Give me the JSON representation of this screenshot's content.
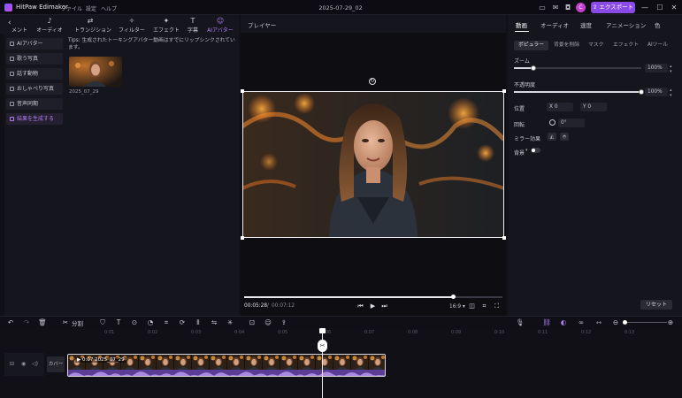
{
  "app": {
    "name": "HitPaw Edimakor",
    "doc_title": "2025-07-29_02",
    "avatar_letter": "C",
    "export_label": "エクスポート"
  },
  "menu": [
    "ファイル",
    "設定",
    "ヘルプ"
  ],
  "toolbar_tabs": [
    {
      "label": "メント",
      "icon": "media-icon"
    },
    {
      "label": "オーディオ",
      "icon": "music-note-icon"
    },
    {
      "label": "トランジション",
      "icon": "transition-icon"
    },
    {
      "label": "フィルター",
      "icon": "filter-icon"
    },
    {
      "label": "エフェクト",
      "icon": "effect-icon"
    },
    {
      "label": "字幕",
      "icon": "subtitle-icon"
    },
    {
      "label": "AIアバター",
      "icon": "ai-avatar-icon",
      "active": true
    }
  ],
  "sidebar": [
    {
      "label": "AIアバター"
    },
    {
      "label": "歌う写真"
    },
    {
      "label": "話す動物"
    },
    {
      "label": "おしゃべり写真"
    },
    {
      "label": "音声同期"
    },
    {
      "label": "結果を生成する",
      "active": true
    }
  ],
  "tips": "Tips: 生成されたトーキングアバター動画はすでにリップシンクされています。",
  "media": {
    "thumb_name": "2025_07_29"
  },
  "player": {
    "label": "プレイヤー",
    "current_time": "00:05:28",
    "separator": "/",
    "total_time": "00:07:12",
    "aspect_ratio": "16:9",
    "progress": 0.81
  },
  "right_panel": {
    "tabs": [
      "動画",
      "オーディオ",
      "速度",
      "アニメーション",
      "色"
    ],
    "sub_tabs": [
      "ボピュラー",
      "背景を削除",
      "マスク",
      "エフェクト",
      "AIツール"
    ],
    "zoom": {
      "label": "ズーム",
      "value": "100%",
      "level": 0.15
    },
    "opacity": {
      "label": "不透明度",
      "value": "100%",
      "level": 1.0
    },
    "position": {
      "label": "位置",
      "x_label": "X",
      "x_value": "0",
      "y_label": "Y",
      "y_value": "0"
    },
    "rotation": {
      "label": "回転",
      "value": "0°"
    },
    "mirror": {
      "label": "ミラー効果"
    },
    "background": {
      "label": "背景"
    },
    "reset_label": "リセット"
  },
  "timeline": {
    "split_label": "分割",
    "ruler": [
      "0:01",
      "0:02",
      "0:03",
      "0:04",
      "0:05",
      "0:06",
      "0:07",
      "0:08",
      "0:09",
      "0:10",
      "0:11",
      "0:12",
      "0:13"
    ],
    "cover_label": "カバー",
    "clip_label": "0:07  2025_07_29"
  },
  "colors": {
    "accent": "#8a4ae8",
    "active_text": "#b17cf4",
    "bg": "#101016"
  }
}
